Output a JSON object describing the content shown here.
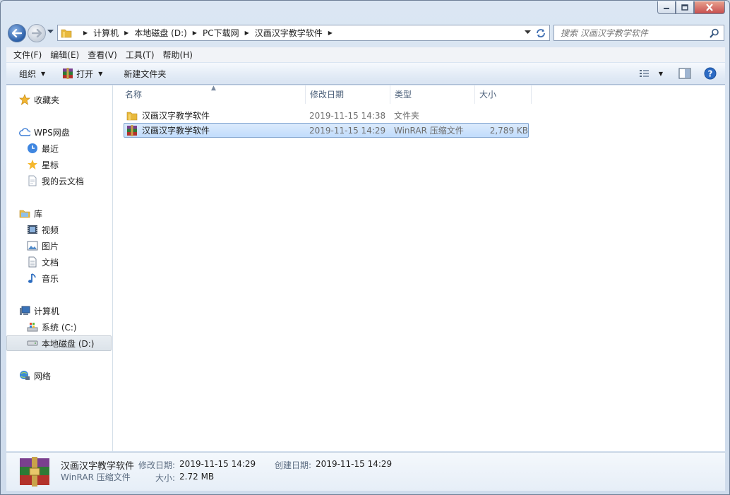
{
  "window": {
    "caption": {
      "minimize": "minimize",
      "maximize": "maximize",
      "close": "close"
    }
  },
  "address": {
    "crumbs": [
      "计算机",
      "本地磁盘 (D:)",
      "PC下载网",
      "汉画汉字教学软件"
    ],
    "search_placeholder": "搜索 汉画汉字教学软件"
  },
  "menu": [
    "文件(F)",
    "编辑(E)",
    "查看(V)",
    "工具(T)",
    "帮助(H)"
  ],
  "toolbar": {
    "organize": "组织",
    "open": "打开",
    "new_folder": "新建文件夹"
  },
  "nav": {
    "favorites": "收藏夹",
    "wps": "WPS网盘",
    "recent": "最近",
    "starred": "星标",
    "cloud_docs": "我的云文档",
    "libraries": "库",
    "videos": "视频",
    "pictures": "图片",
    "documents": "文档",
    "music": "音乐",
    "computer": "计算机",
    "drive_c": "系统 (C:)",
    "drive_d": "本地磁盘 (D:)",
    "network": "网络"
  },
  "columns": {
    "name": "名称",
    "date": "修改日期",
    "type": "类型",
    "size": "大小"
  },
  "files": [
    {
      "name": "汉画汉字教学软件",
      "date": "2019-11-15 14:38",
      "type": "文件夹",
      "size": "",
      "icon": "folder-icon"
    },
    {
      "name": "汉画汉字教学软件",
      "date": "2019-11-15 14:29",
      "type": "WinRAR 压缩文件",
      "size": "2,789 KB",
      "icon": "winrar-icon"
    }
  ],
  "details": {
    "name": "汉画汉字教学软件",
    "type": "WinRAR 压缩文件",
    "modified_label": "修改日期:",
    "modified": "2019-11-15 14:29",
    "created_label": "创建日期:",
    "created": "2019-11-15 14:29",
    "size_label": "大小:",
    "size": "2.72 MB"
  },
  "colors": {
    "selection": "#c1dcfc",
    "selection_border": "#7da2ce",
    "folder": "#e8b93c"
  }
}
